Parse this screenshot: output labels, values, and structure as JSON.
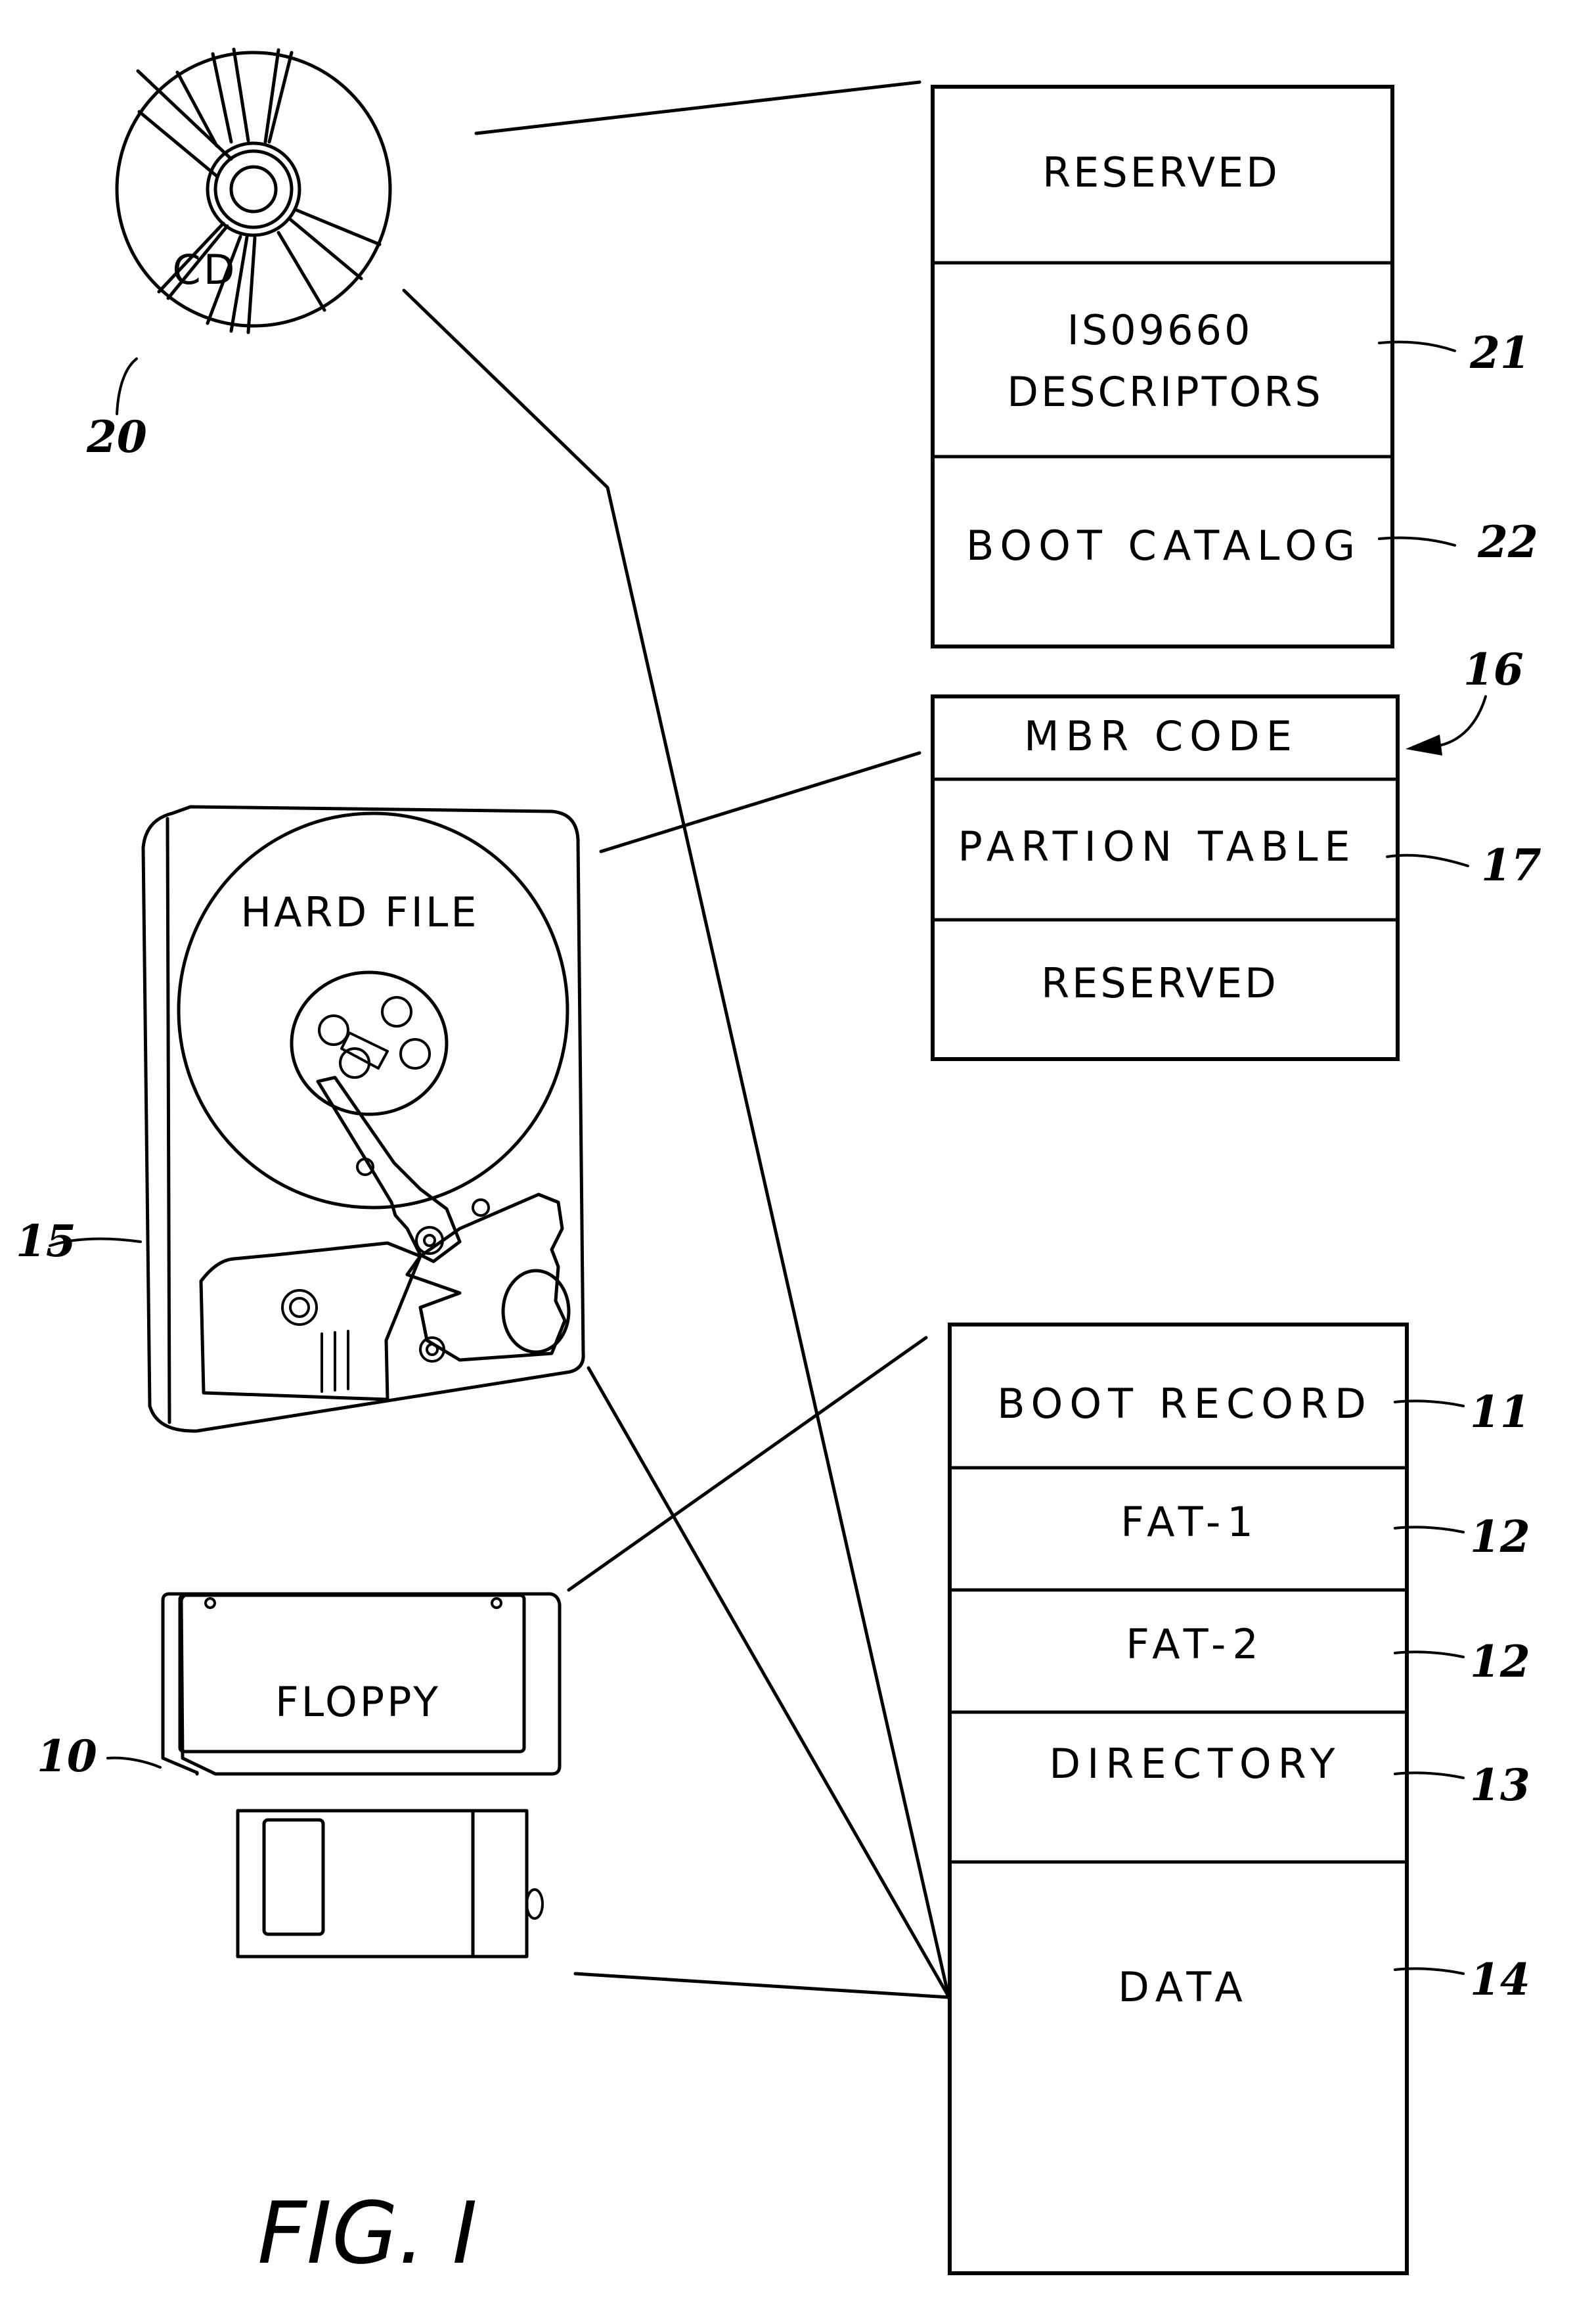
{
  "figure": {
    "title": "FIG. I"
  },
  "devices": {
    "cd": {
      "label": "CD",
      "ref": "20"
    },
    "hard_file": {
      "label": "HARD FILE",
      "ref": "15"
    },
    "floppy": {
      "label": "FLOPPY",
      "ref": "10"
    }
  },
  "cd_layout": {
    "segments": [
      {
        "label": "RESERVED",
        "ref": ""
      },
      {
        "label_line1": "IS09660",
        "label_line2": "DESCRIPTORS",
        "ref": "21"
      },
      {
        "label": "BOOT CATALOG",
        "ref": "22"
      }
    ]
  },
  "mbr_layout": {
    "ref": "16",
    "segments": [
      {
        "label": "MBR CODE",
        "ref": ""
      },
      {
        "label": "PARTION TABLE",
        "ref": "17"
      },
      {
        "label": "RESERVED",
        "ref": ""
      }
    ]
  },
  "fat_layout": {
    "segments": [
      {
        "label": "BOOT RECORD",
        "ref": "11"
      },
      {
        "label": "FAT-1",
        "ref": "12"
      },
      {
        "label": "FAT-2",
        "ref": "12"
      },
      {
        "label": "DIRECTORY",
        "ref": "13"
      },
      {
        "label": "DATA",
        "ref": "14"
      }
    ]
  }
}
